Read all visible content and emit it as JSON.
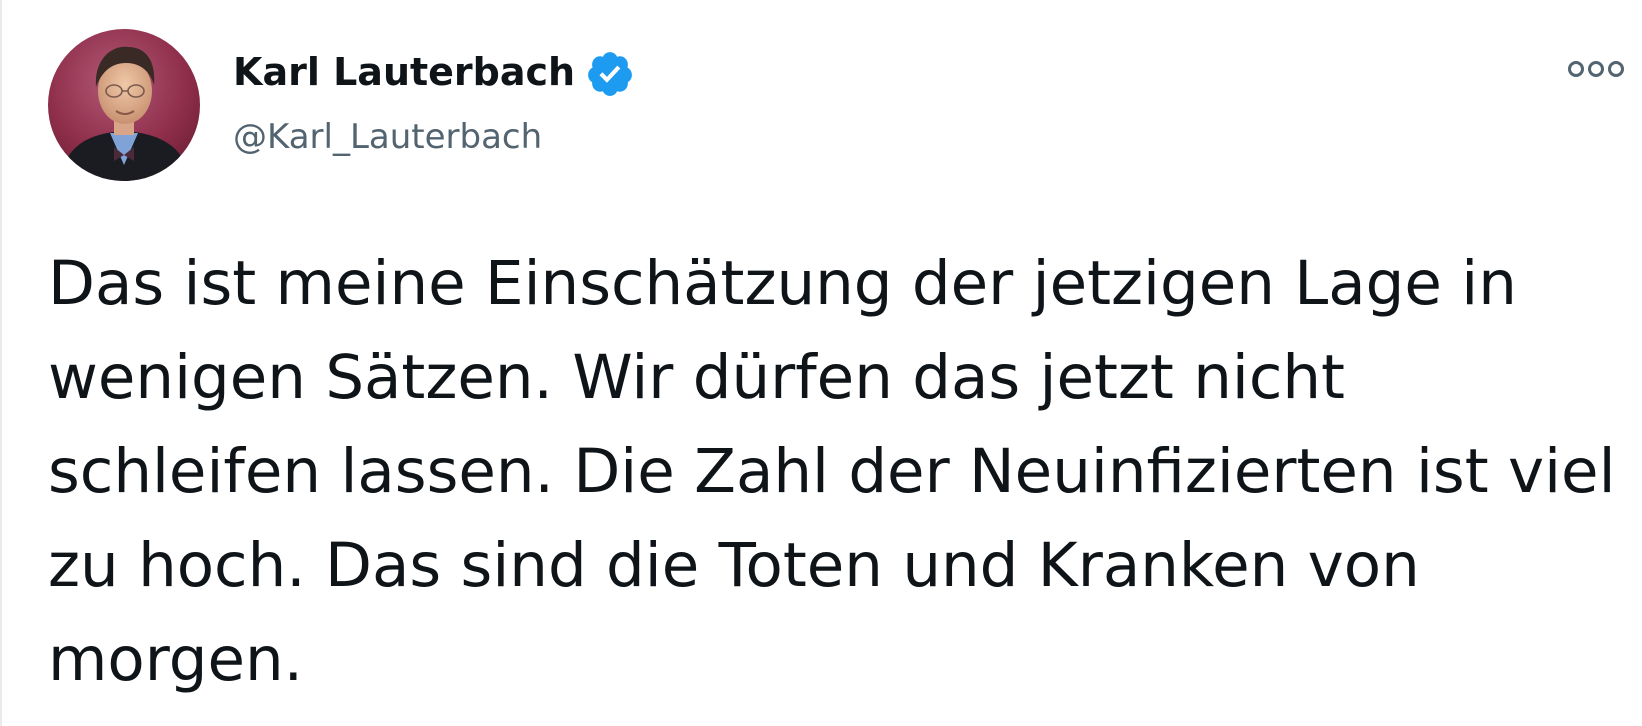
{
  "author": {
    "name": "Karl Lauterbach",
    "handle": "@Karl_Lauterbach",
    "verified": true
  },
  "icons": {
    "avatar": "profile-photo",
    "verified": "verified-badge-icon",
    "more": "more-options-icon"
  },
  "tweet": {
    "text": "Das ist meine Einschätzung der jetzigen Lage in wenigen Sätzen. Wir dürfen das jetzt nicht schleifen lassen. Die Zahl der Neuinfizierten ist viel zu hoch. Das sind die Toten und Kranken von morgen."
  },
  "colors": {
    "text_primary": "#0f1419",
    "text_secondary": "#536471",
    "verified_blue": "#1d9bf0",
    "background": "#ffffff"
  }
}
